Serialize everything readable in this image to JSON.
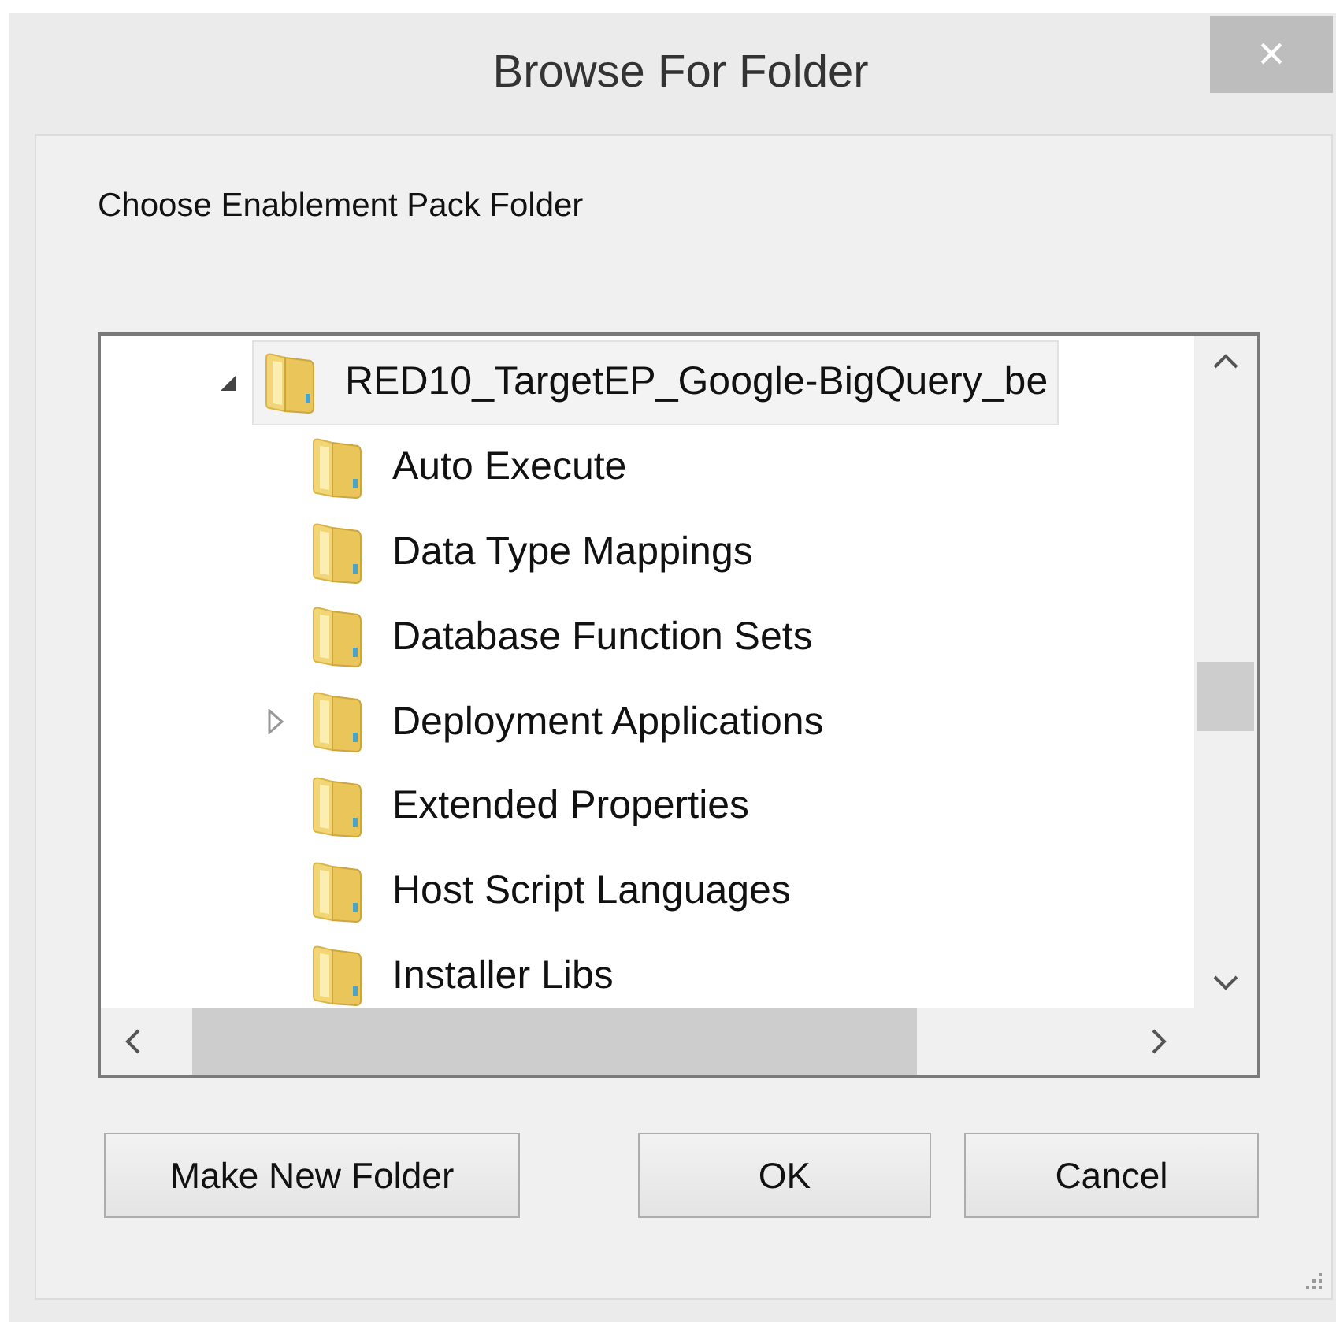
{
  "window": {
    "title": "Browse For Folder",
    "close": "×"
  },
  "prompt": "Choose Enablement Pack Folder",
  "tree": [
    {
      "label": "RED10_TargetEP_Google-BigQuery_be",
      "expanded": true,
      "selected": true,
      "children": [
        {
          "label": "Auto Execute",
          "selected": false
        },
        {
          "label": "Data Type Mappings",
          "selected": false
        },
        {
          "label": "Database Function Sets",
          "selected": false
        },
        {
          "label": "Deployment Applications",
          "selected": false,
          "expanded": false
        },
        {
          "label": "Extended Properties",
          "selected": false
        },
        {
          "label": "Host Script Languages",
          "selected": false
        },
        {
          "label": "Installer Libs",
          "selected": false
        }
      ]
    }
  ],
  "buttons": [
    "Make New Folder",
    "OK",
    "Cancel"
  ]
}
